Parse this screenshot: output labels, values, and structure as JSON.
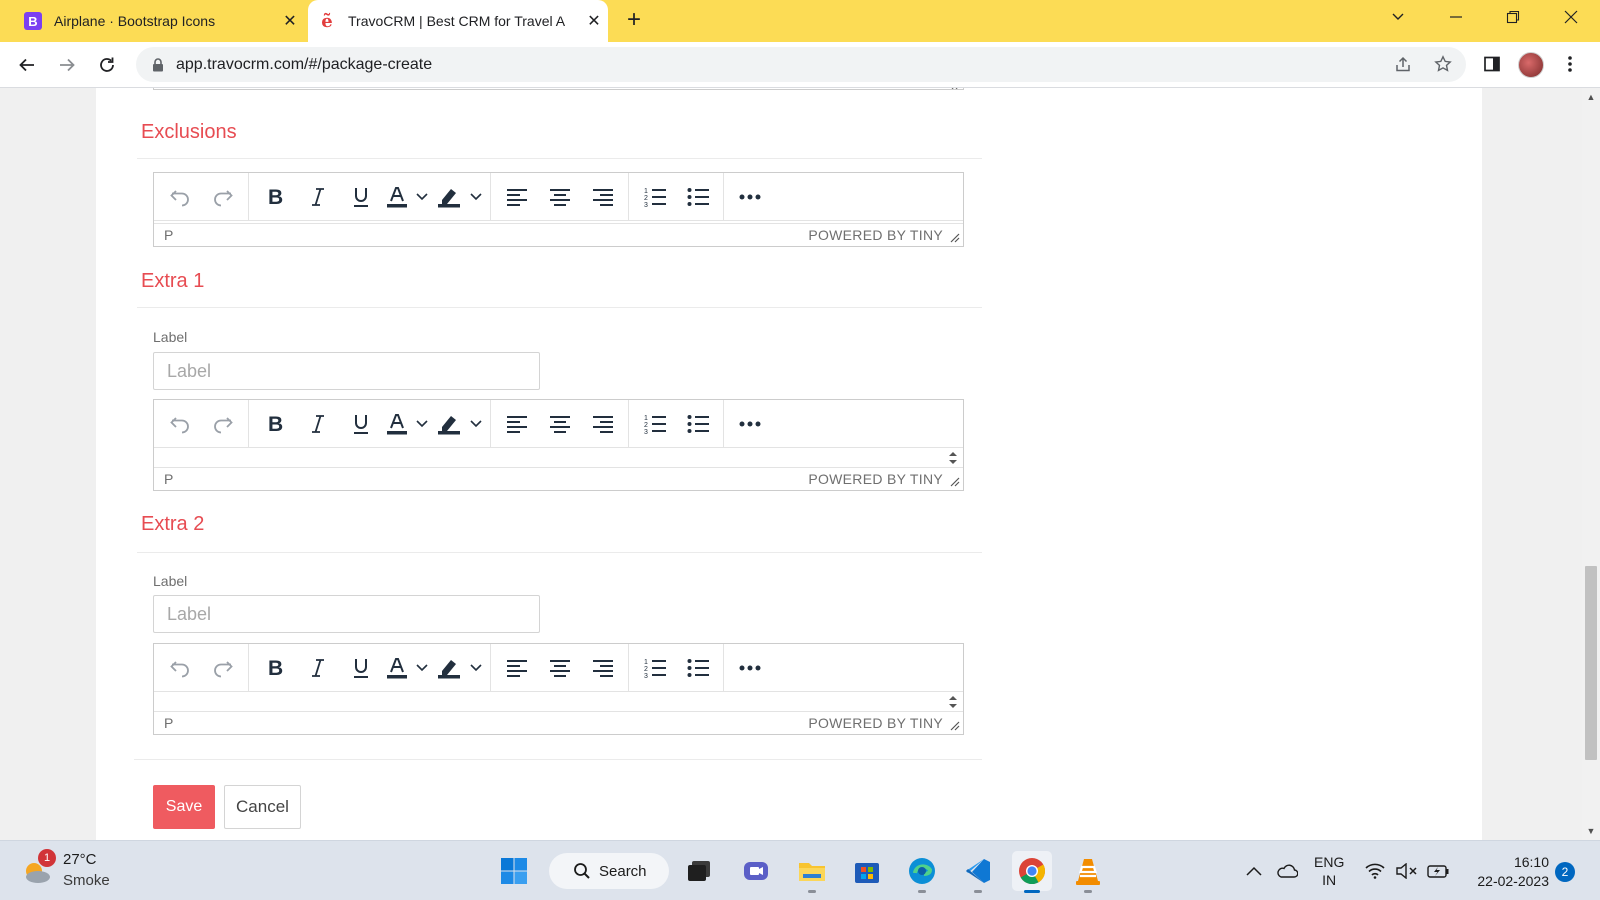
{
  "browser": {
    "tabs": [
      {
        "title": "Airplane · Bootstrap Icons",
        "favicon": "bootstrap-icon",
        "active": false
      },
      {
        "title": "TravoCRM | Best CRM for Travel A",
        "favicon": "travocrm-icon",
        "active": true
      }
    ],
    "url": "app.travocrm.com/#/package-create"
  },
  "page": {
    "sections": {
      "exclusions": {
        "title": "Exclusions"
      },
      "extra1": {
        "title": "Extra 1",
        "label_caption": "Label",
        "label_placeholder": "Label"
      },
      "extra2": {
        "title": "Extra 2",
        "label_caption": "Label",
        "label_placeholder": "Label"
      }
    },
    "editor": {
      "status_element": "P",
      "powered_by": "POWERED BY TINY",
      "toolbar_icons": [
        "undo-icon",
        "redo-icon",
        "bold-icon",
        "italic-icon",
        "underline-icon",
        "text-color-icon",
        "highlight-icon",
        "align-left-icon",
        "align-center-icon",
        "align-right-icon",
        "numbered-list-icon",
        "bullet-list-icon",
        "more-icon"
      ]
    },
    "actions": {
      "save_label": "Save",
      "cancel_label": "Cancel"
    },
    "colors": {
      "accent": "#e74c52",
      "save_button": "#ef5b60"
    }
  },
  "taskbar": {
    "weather": {
      "badge": "1",
      "temp": "27°C",
      "condition": "Smoke"
    },
    "search_label": "Search",
    "apps": [
      "windows-start-icon",
      "file-explorer-dark-icon",
      "teams-icon",
      "file-explorer-icon",
      "microsoft-store-icon",
      "edge-icon",
      "vscode-icon",
      "chrome-icon",
      "vlc-icon"
    ],
    "lang_line1": "ENG",
    "lang_line2": "IN",
    "time": "16:10",
    "date": "22-02-2023",
    "notification_count": "2"
  }
}
